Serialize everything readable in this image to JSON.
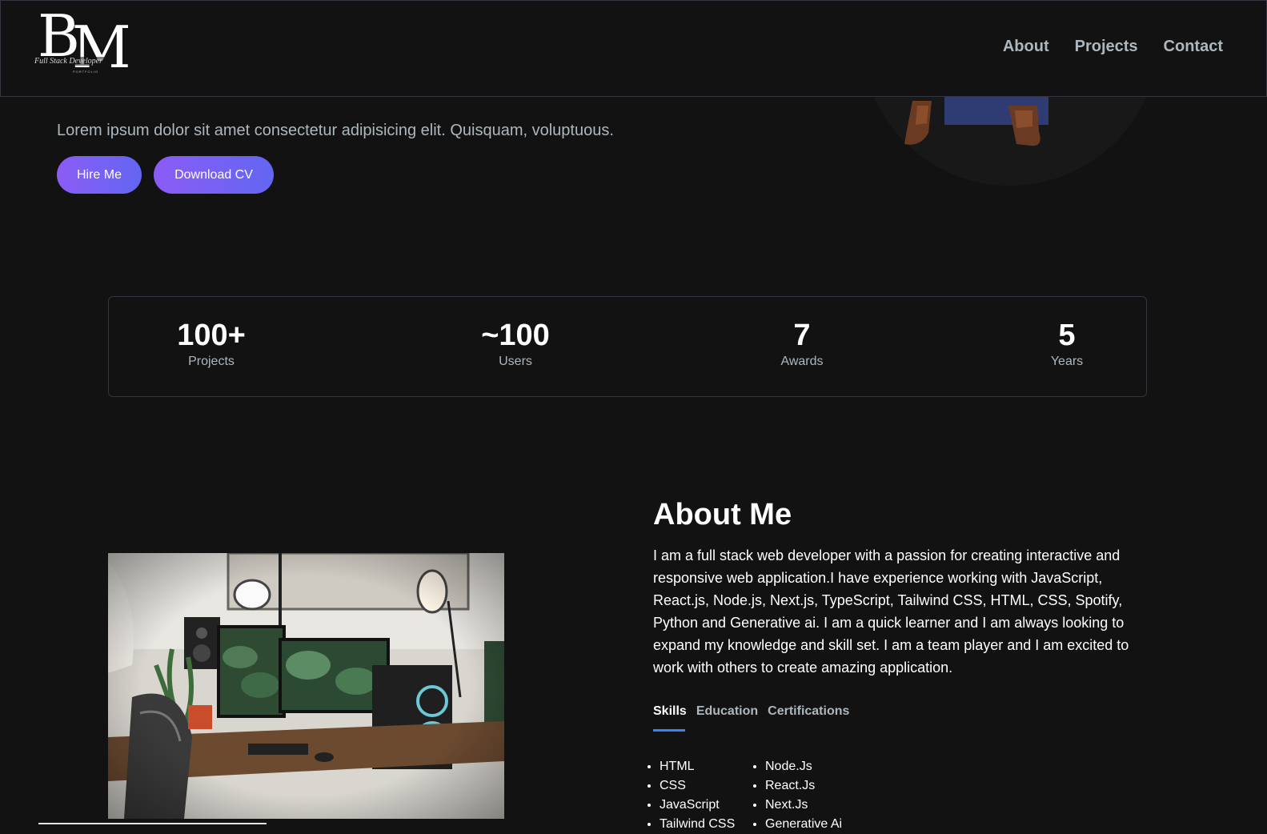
{
  "nav": {
    "logo_initials_1": "B",
    "logo_initials_2": "M",
    "logo_script": "Full Stack Developer",
    "logo_sub": "PORTFOLIO",
    "links": [
      "About",
      "Projects",
      "Contact"
    ]
  },
  "hero": {
    "text": "Lorem ipsum dolor sit amet consectetur adipisicing elit. Quisquam, voluptuous.",
    "hire_label": "Hire Me",
    "cv_label": "Download CV"
  },
  "stats": [
    {
      "value": "100+",
      "label": "Projects"
    },
    {
      "value": "~100",
      "label": "Users"
    },
    {
      "value": "7",
      "label": "Awards"
    },
    {
      "value": "5",
      "label": "Years"
    }
  ],
  "about": {
    "title": "About Me",
    "description": "I am a full stack web developer with a passion for creating interactive and responsive web application.I have experience working with JavaScript, React.js, Node.js, Next.js, TypeScript, Tailwind CSS, HTML, CSS, Spotify, Python and Generative ai. I am a quick learner and I am always looking to expand my knowledge and skill set. I am a team player and I am excited to work with others to create amazing application.",
    "tabs": [
      "Skills",
      "Education",
      "Certifications"
    ],
    "active_tab": "Skills",
    "skills_col1": [
      "HTML",
      "CSS",
      "JavaScript",
      "Tailwind CSS"
    ],
    "skills_col2": [
      "Node.Js",
      "React.Js",
      "Next.Js",
      "Generative Ai"
    ]
  },
  "colors": {
    "background": "#121212",
    "muted_text": "#ADB7BE",
    "button_gradient_start": "#8b5cf6",
    "button_gradient_end": "#6366f1",
    "tab_underline": "#3b82f6"
  }
}
